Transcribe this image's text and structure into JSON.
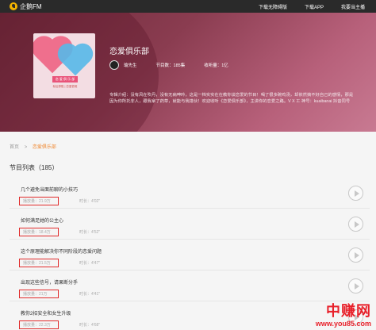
{
  "app": {
    "logo_text": "企鹅FM"
  },
  "topnav": {
    "items": [
      "下载无障碍版",
      "下载APP",
      "我要当主播"
    ]
  },
  "album": {
    "title": "恋爱俱乐部",
    "cover_tag": "恋 爱 俱 乐 部",
    "cover_sub": "秋后算账 | 恋爱很难",
    "author": "瑜先生",
    "episodes_count": "节目数：185集",
    "subscribers": "收听量：1亿",
    "description": "专辑介绍：没有风在吹丹，没有无病呻吟，这是一档实实在在教你谈恋爱的节目！喝了很多碗鸡汤，却依然搞不好自己的感情，那是因为你所托非人，跟我拿了药草，就能与我搭伙！欢迎收听《恋爱俱乐部》，主讲你的恋爱之路。V X 工 神号：kuaibanai 抖音同号"
  },
  "breadcrumb": {
    "home": "首页",
    "sep": ">",
    "current": "恋爱俱乐部"
  },
  "list": {
    "title": "节目列表（185）"
  },
  "episodes": [
    {
      "title": "几个避免当面前聊的小技巧",
      "plays": "播放量：21.9万",
      "duration": "时长：4'02\""
    },
    {
      "title": "如何满足她的公主心",
      "plays": "播放量：18.4万",
      "duration": "时长：4'52\""
    },
    {
      "title": "这个原理能解决你不同阶段的恋爱问题",
      "plays": "播放量：21.5万",
      "duration": "时长：4'47\""
    },
    {
      "title": "出现这些信号，请果断分手",
      "plays": "播放量：21万",
      "duration": "时长：4'41\""
    },
    {
      "title": "教你2招安全和女生升级",
      "plays": "播放量：22.3万",
      "duration": "时长：4'68\""
    }
  ],
  "watermark": {
    "cn": "中赚网",
    "url": "www.you85.com"
  },
  "colors": {
    "accent": "#f08a34",
    "highlight_box": "#e02a2a",
    "topbar": "#2a2a2a"
  }
}
